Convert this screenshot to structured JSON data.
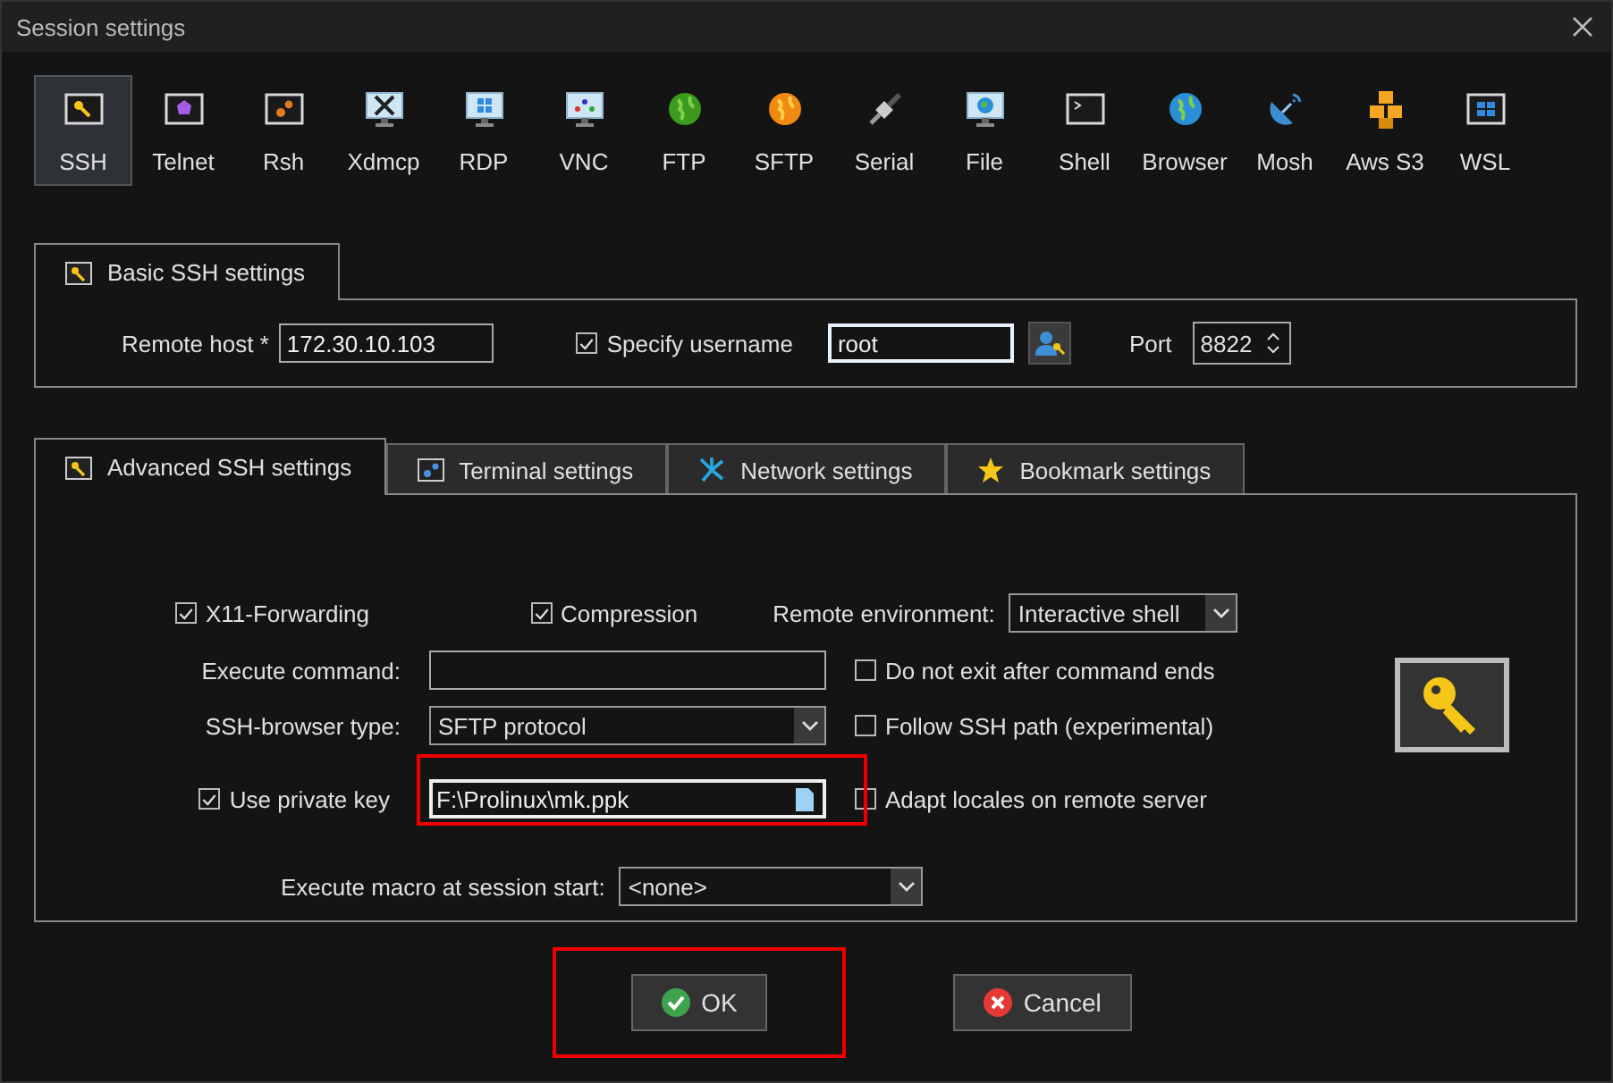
{
  "window": {
    "title": "Session settings"
  },
  "session_types": [
    {
      "label": "SSH",
      "kind": "key-frame",
      "selected": true
    },
    {
      "label": "Telnet",
      "kind": "gem-frame",
      "selected": false
    },
    {
      "label": "Rsh",
      "kind": "gear-frame",
      "selected": false
    },
    {
      "label": "Xdmcp",
      "kind": "x-monitor",
      "selected": false
    },
    {
      "label": "RDP",
      "kind": "windows-monitor",
      "selected": false
    },
    {
      "label": "VNC",
      "kind": "vnc-monitor",
      "selected": false
    },
    {
      "label": "FTP",
      "kind": "green-globe",
      "selected": false
    },
    {
      "label": "SFTP",
      "kind": "orange-globe",
      "selected": false
    },
    {
      "label": "Serial",
      "kind": "plug",
      "selected": false
    },
    {
      "label": "File",
      "kind": "globe-monitor",
      "selected": false
    },
    {
      "label": "Shell",
      "kind": "prompt-frame",
      "selected": false
    },
    {
      "label": "Browser",
      "kind": "blue-globe",
      "selected": false
    },
    {
      "label": "Mosh",
      "kind": "dish",
      "selected": false
    },
    {
      "label": "Aws S3",
      "kind": "cubes",
      "selected": false
    },
    {
      "label": "WSL",
      "kind": "windows-frame",
      "selected": false
    }
  ],
  "basic_tab": {
    "label": "Basic SSH settings"
  },
  "basic": {
    "remote_host_label": "Remote host *",
    "remote_host": "172.30.10.103",
    "specify_username": {
      "label": "Specify username",
      "checked": true
    },
    "username": "root",
    "port_label": "Port",
    "port": "8822"
  },
  "advanced_tabs": [
    {
      "label": "Advanced SSH settings",
      "kind": "key",
      "selected": true
    },
    {
      "label": "Terminal settings",
      "kind": "terminal",
      "selected": false
    },
    {
      "label": "Network settings",
      "kind": "network",
      "selected": false
    },
    {
      "label": "Bookmark settings",
      "kind": "star",
      "selected": false
    }
  ],
  "advanced": {
    "x11": {
      "label": "X11-Forwarding",
      "checked": true
    },
    "compression": {
      "label": "Compression",
      "checked": true
    },
    "remote_environment_label": "Remote environment:",
    "remote_environment": "Interactive shell",
    "execute_command_label": "Execute command:",
    "do_not_exit": {
      "label": "Do not exit after command ends",
      "checked": false
    },
    "ssh_browser_label": "SSH-browser type:",
    "ssh_browser": "SFTP protocol",
    "follow_ssh_path": {
      "label": "Follow SSH path (experimental)",
      "checked": false
    },
    "use_private_key": {
      "label": "Use private key",
      "checked": true
    },
    "private_key": "F:\\Prolinux\\mk.ppk",
    "private_key_highlighted": true,
    "adapt_locales": {
      "label": "Adapt locales on remote server",
      "checked": false
    },
    "macro_label": "Execute macro at session start:",
    "macro": "<none>"
  },
  "buttons": [
    {
      "kind": "ok",
      "label": "OK",
      "highlighted": true
    },
    {
      "kind": "cancel",
      "label": "Cancel",
      "highlighted": false
    }
  ]
}
